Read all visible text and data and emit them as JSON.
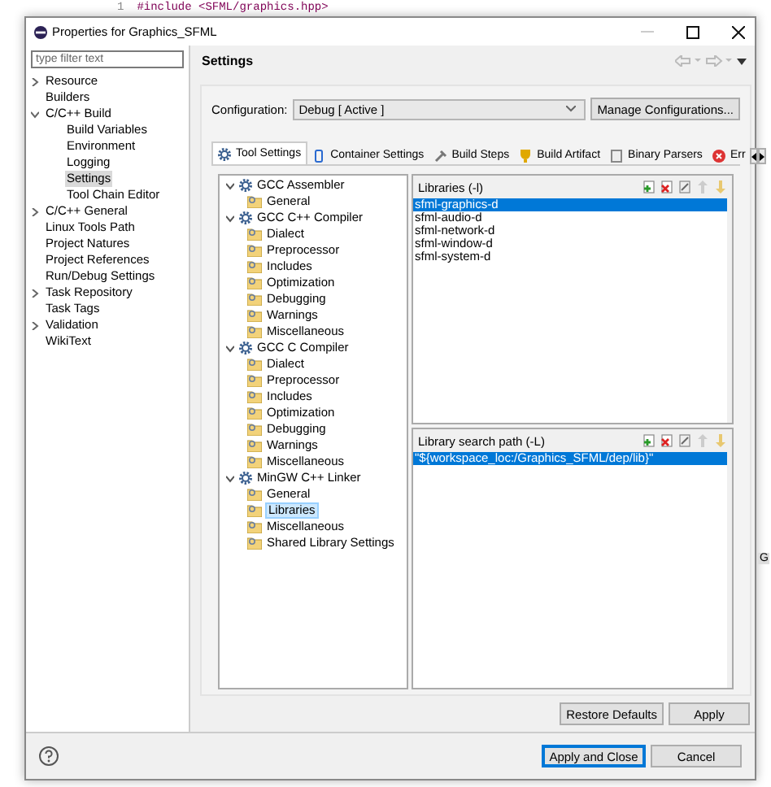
{
  "editor": {
    "line_number": "1",
    "code": "#include <SFML/graphics.hpp>",
    "side_text": "G"
  },
  "window": {
    "title": "Properties for Graphics_SFML"
  },
  "filter": {
    "placeholder": "type filter text"
  },
  "sidebar": {
    "items": [
      {
        "label": "Resource",
        "selected": false,
        "expanded": false
      },
      {
        "label": "Builders",
        "selected": false
      },
      {
        "label": "C/C++ Build",
        "selected": false,
        "expanded": true,
        "children": [
          {
            "label": "Build Variables",
            "selected": false
          },
          {
            "label": "Environment",
            "selected": false
          },
          {
            "label": "Logging",
            "selected": false
          },
          {
            "label": "Settings",
            "selected": true
          },
          {
            "label": "Tool Chain Editor",
            "selected": false
          }
        ]
      },
      {
        "label": "C/C++ General",
        "selected": false,
        "expanded": false
      },
      {
        "label": "Linux Tools Path",
        "selected": false
      },
      {
        "label": "Project Natures",
        "selected": false
      },
      {
        "label": "Project References",
        "selected": false
      },
      {
        "label": "Run/Debug Settings",
        "selected": false
      },
      {
        "label": "Task Repository",
        "selected": false,
        "expanded": false
      },
      {
        "label": "Task Tags",
        "selected": false
      },
      {
        "label": "Validation",
        "selected": false,
        "expanded": false
      },
      {
        "label": "WikiText",
        "selected": false
      }
    ]
  },
  "page_title": "Settings",
  "configuration": {
    "label": "Configuration:",
    "value": "Debug  [ Active ]",
    "button": "Manage Configurations..."
  },
  "tabs": [
    {
      "label": "Tool Settings",
      "selected": true
    },
    {
      "label": "Container Settings",
      "selected": false
    },
    {
      "label": "Build Steps",
      "selected": false
    },
    {
      "label": "Build Artifact",
      "selected": false
    },
    {
      "label": "Binary Parsers",
      "selected": false
    },
    {
      "label": "Err",
      "selected": false
    }
  ],
  "tool_tree": [
    {
      "label": "GCC Assembler",
      "expanded": true,
      "selected": false,
      "children": [
        {
          "label": "General",
          "selected": false
        }
      ]
    },
    {
      "label": "GCC C++ Compiler",
      "expanded": true,
      "selected": false,
      "children": [
        {
          "label": "Dialect",
          "selected": false
        },
        {
          "label": "Preprocessor",
          "selected": false
        },
        {
          "label": "Includes",
          "selected": false
        },
        {
          "label": "Optimization",
          "selected": false
        },
        {
          "label": "Debugging",
          "selected": false
        },
        {
          "label": "Warnings",
          "selected": false
        },
        {
          "label": "Miscellaneous",
          "selected": false
        }
      ]
    },
    {
      "label": "GCC C Compiler",
      "expanded": true,
      "selected": false,
      "children": [
        {
          "label": "Dialect",
          "selected": false
        },
        {
          "label": "Preprocessor",
          "selected": false
        },
        {
          "label": "Includes",
          "selected": false
        },
        {
          "label": "Optimization",
          "selected": false
        },
        {
          "label": "Debugging",
          "selected": false
        },
        {
          "label": "Warnings",
          "selected": false
        },
        {
          "label": "Miscellaneous",
          "selected": false
        }
      ]
    },
    {
      "label": "MinGW C++ Linker",
      "expanded": true,
      "selected": false,
      "children": [
        {
          "label": "General",
          "selected": false
        },
        {
          "label": "Libraries",
          "selected": true
        },
        {
          "label": "Miscellaneous",
          "selected": false
        },
        {
          "label": "Shared Library Settings",
          "selected": false
        }
      ]
    }
  ],
  "lists": [
    {
      "title": "Libraries (-l)",
      "items": [
        {
          "label": "sfml-graphics-d",
          "selected": true
        },
        {
          "label": "sfml-audio-d",
          "selected": false
        },
        {
          "label": "sfml-network-d",
          "selected": false
        },
        {
          "label": "sfml-window-d",
          "selected": false
        },
        {
          "label": "sfml-system-d",
          "selected": false
        }
      ]
    },
    {
      "title": "Library search path (-L)",
      "items": [
        {
          "label": "\"${workspace_loc:/Graphics_SFML/dep/lib}\"",
          "selected": true
        }
      ]
    }
  ],
  "page_buttons": [
    "Restore Defaults",
    "Apply"
  ],
  "dialog_buttons": [
    {
      "label": "Apply and Close",
      "default": true
    },
    {
      "label": "Cancel",
      "default": false
    }
  ]
}
